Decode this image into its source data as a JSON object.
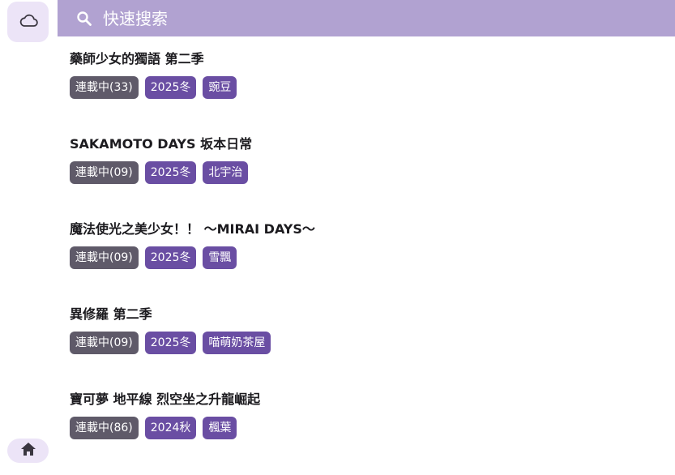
{
  "nav": {
    "top_icon": "cloud-icon",
    "bottom_icon": "home-icon"
  },
  "search": {
    "placeholder": "快速搜索",
    "icon": "search-icon"
  },
  "colors": {
    "search_bar": "#b1a2d1",
    "status_tag": "#5f5a69",
    "accent_tag": "#6a4ea3",
    "nav_button": "#ece4f7"
  },
  "items": [
    {
      "title": "藥師少女的獨語 第二季",
      "status": "連載中(33)",
      "season": "2025冬",
      "group": "豌豆"
    },
    {
      "title": "SAKAMOTO DAYS 坂本日常",
      "status": "連載中(09)",
      "season": "2025冬",
      "group": "北宇治"
    },
    {
      "title": "魔法使光之美少女！！ ～MIRAI DAYS～",
      "status": "連載中(09)",
      "season": "2025冬",
      "group": "雪飄"
    },
    {
      "title": "異修羅 第二季",
      "status": "連載中(09)",
      "season": "2025冬",
      "group": "喵萌奶茶屋"
    },
    {
      "title": "寶可夢 地平線 烈空坐之升龍崛起",
      "status": "連載中(86)",
      "season": "2024秋",
      "group": "楓葉"
    }
  ]
}
